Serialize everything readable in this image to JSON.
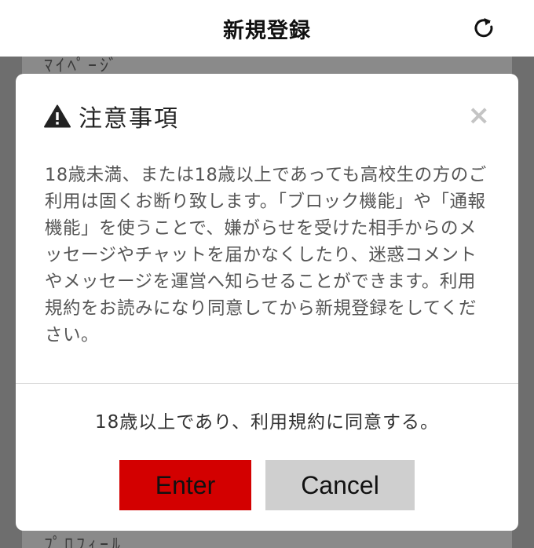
{
  "header": {
    "title": "新規登録"
  },
  "background": {
    "top_text": "ﾏｲﾍﾟｰｼﾞ",
    "bottom_text": "ﾌﾟﾛﾌｨｰﾙ"
  },
  "modal": {
    "title": "注意事項",
    "close_label": "×",
    "body": "18歳未満、または18歳以上であっても高校生の方のご利用は固くお断り致します。「ブロック機能」や「通報機能」を使うことで、嫌がらせを受けた相手からのメッセージやチャットを届かなくしたり、迷惑コメントやメッセージを運営へ知らせることができます。利用規約をお読みになり同意してから新規登録をしてください。",
    "confirm_text": "18歳以上であり、利用規約に同意する。",
    "enter_label": "Enter",
    "cancel_label": "Cancel"
  },
  "icons": {
    "reload": "reload-icon",
    "warning": "warning-icon",
    "close": "close-icon"
  },
  "colors": {
    "enter_bg": "#d30000",
    "cancel_bg": "#cfcfcf"
  }
}
